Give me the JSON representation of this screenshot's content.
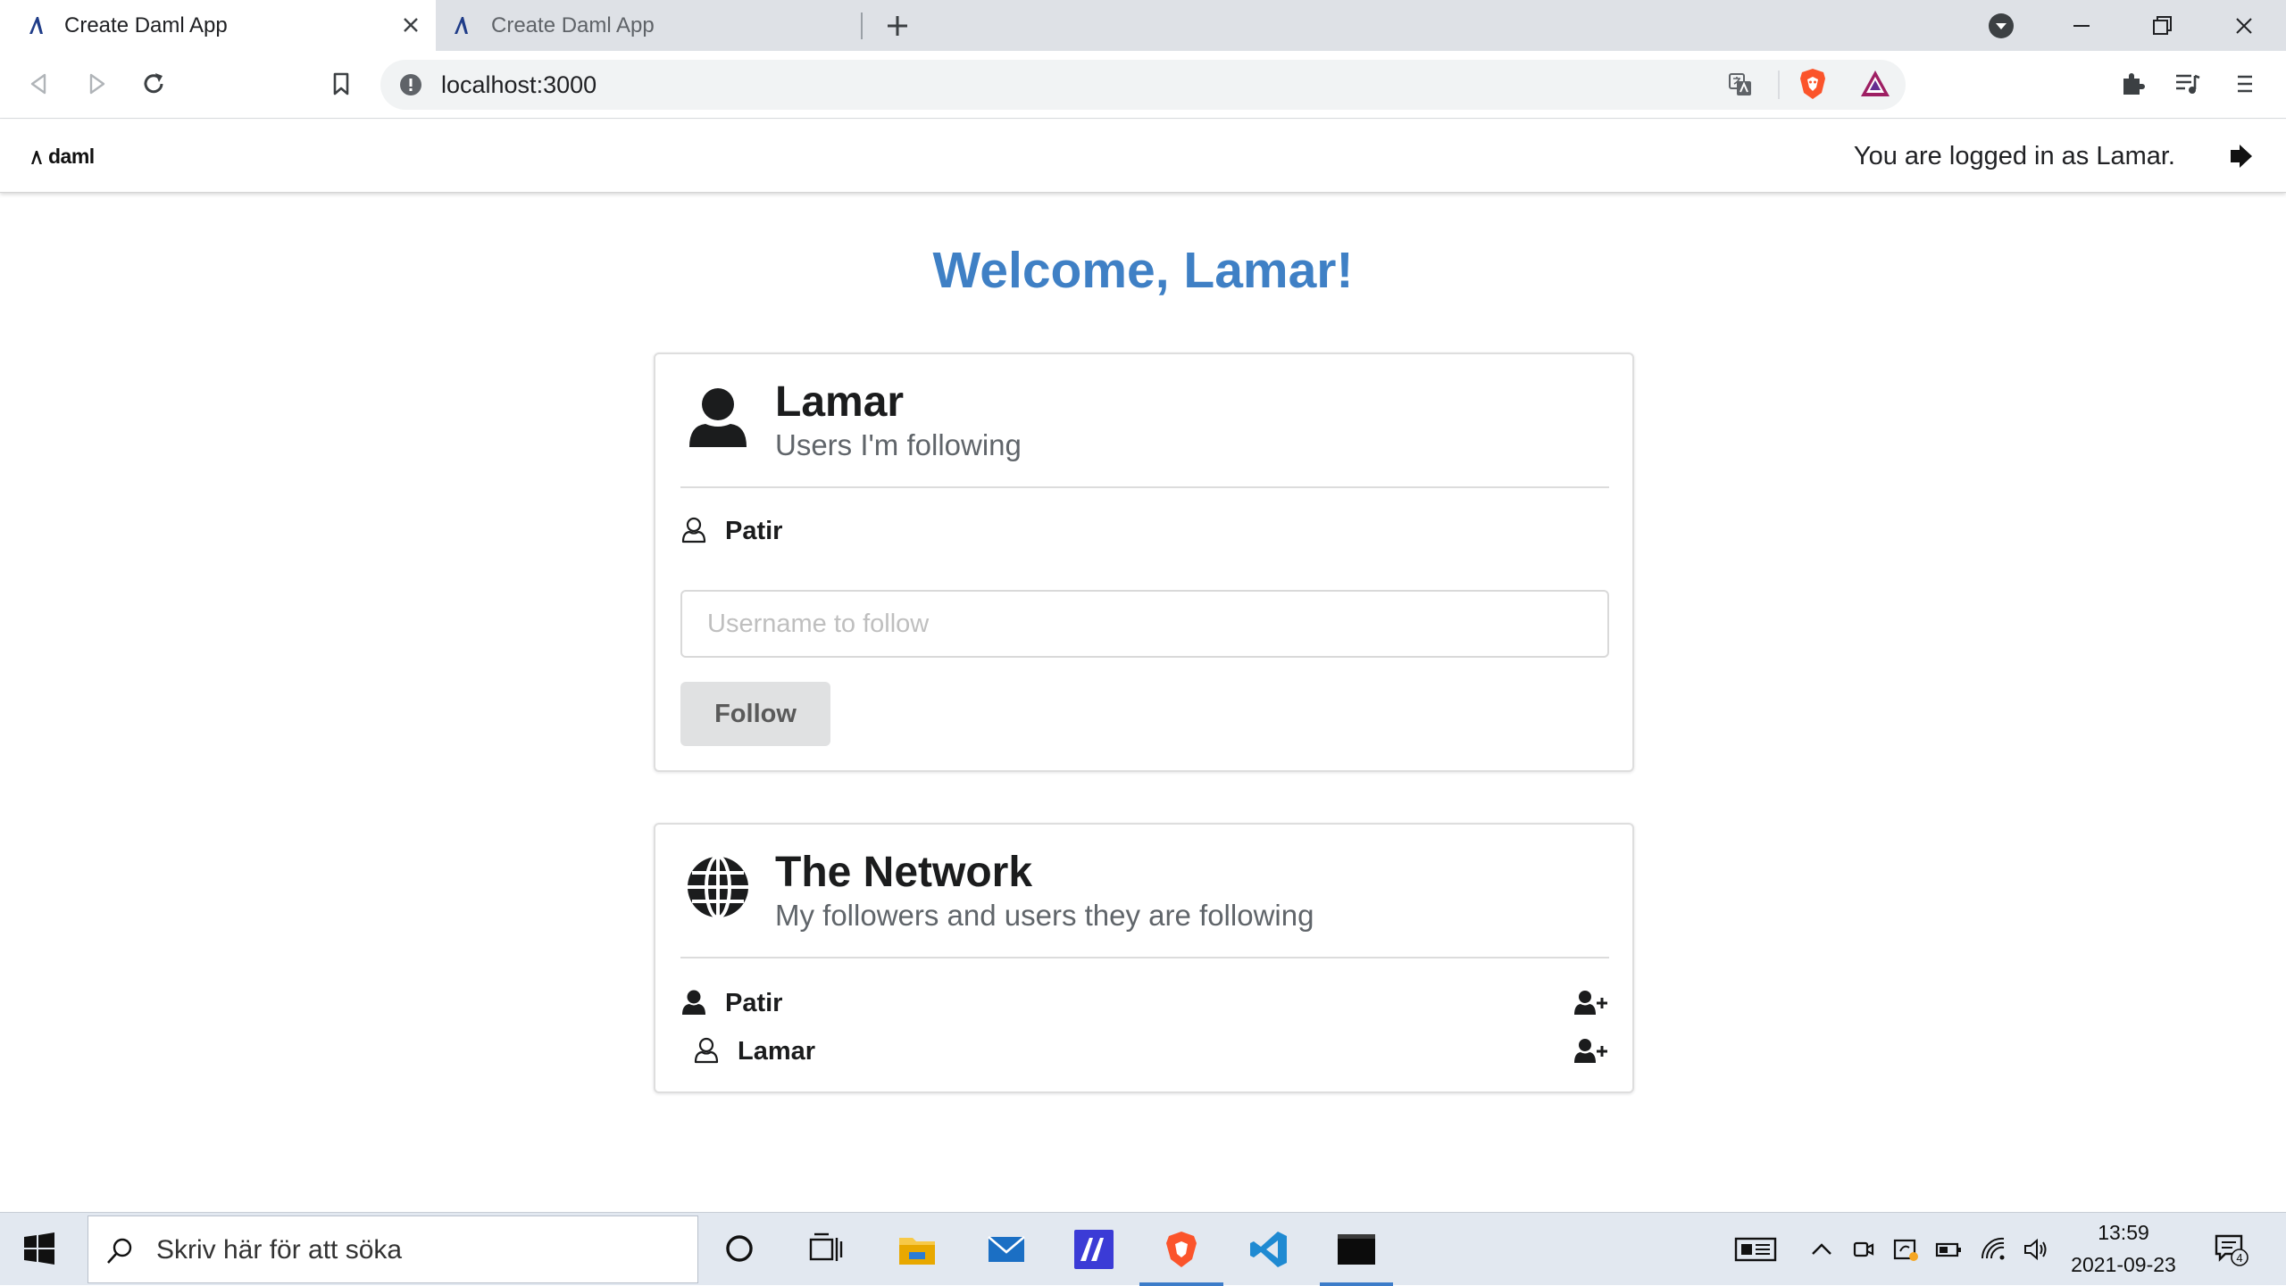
{
  "browser": {
    "tabs": [
      {
        "title": "Create Daml App",
        "active": true
      },
      {
        "title": "Create Daml App",
        "active": false
      }
    ],
    "url": "localhost:3000"
  },
  "header": {
    "logo_text": "daml",
    "logged_in_text": "You are logged in as Lamar."
  },
  "main": {
    "welcome": "Welcome, Lamar!",
    "following_card": {
      "title": "Lamar",
      "subtitle": "Users I'm following",
      "users": [
        "Patir"
      ],
      "input_placeholder": "Username to follow",
      "input_value": "",
      "follow_button": "Follow"
    },
    "network_card": {
      "title": "The Network",
      "subtitle": "My followers and users they are following",
      "users": [
        "Patir",
        "Lamar"
      ]
    }
  },
  "taskbar": {
    "search_placeholder": "Skriv här för att söka",
    "time": "13:59",
    "date": "2021-09-23",
    "notification_count": "4"
  },
  "colors": {
    "accent": "#3f80c5",
    "taskbar": "#e2e8f0",
    "tabstrip": "#dee1e6"
  }
}
